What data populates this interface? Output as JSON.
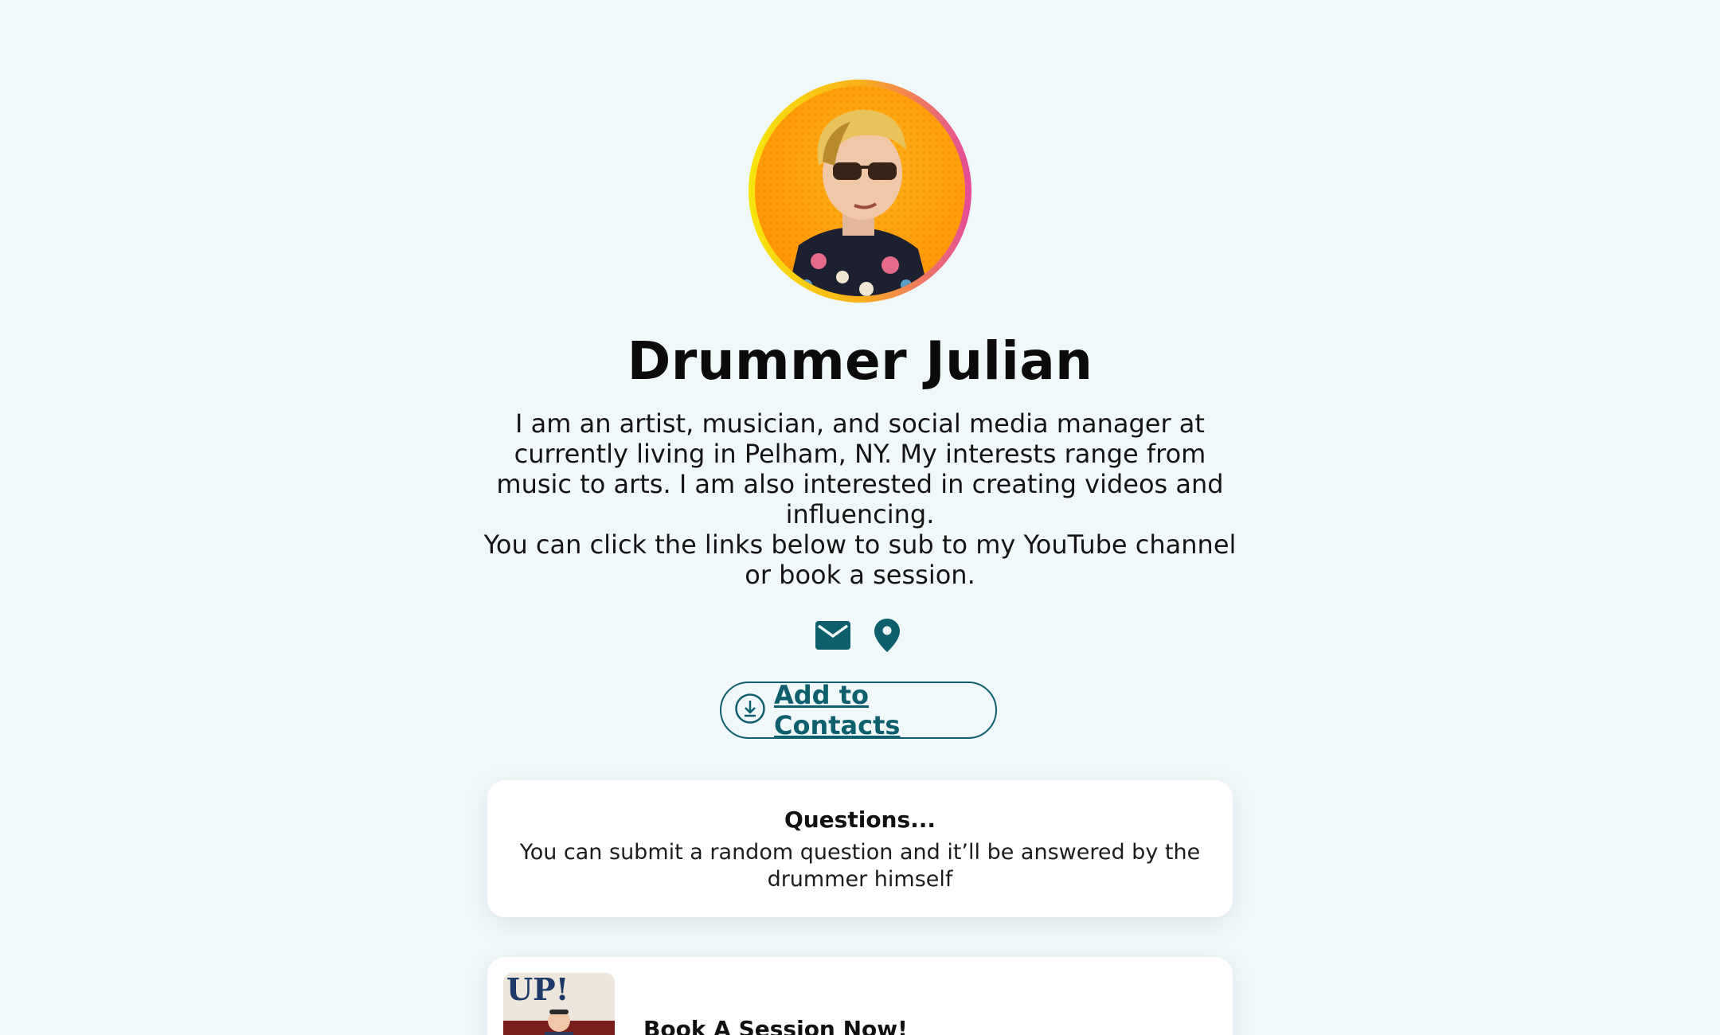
{
  "profile": {
    "name": "Drummer Julian",
    "avatar_alt": "Drummer Julian avatar",
    "bio_lines": [
      "I am an artist, musician, and social media manager at currently living in Pelham, NY. My interests range from music to arts. I am also interested in creating videos and influencing.",
      "You can click the links below to sub to my YouTube channel or book a session."
    ]
  },
  "contact_icons": [
    {
      "icon": "mail-icon"
    },
    {
      "icon": "location-pin-icon"
    }
  ],
  "add_contacts": {
    "label": "Add to Contacts",
    "icon": "download-circle-icon"
  },
  "questions_card": {
    "title": "Questions...",
    "text": "You can submit a random question and it’ll be answered by the drummer himself"
  },
  "session_card": {
    "label": "Book A Session Now!",
    "thumb_text": "UP!"
  },
  "colors": {
    "background": "#f1f8fa",
    "accent": "#0d5f6e",
    "avatar_ring_start": "#f5e60c",
    "avatar_ring_end": "#e44a9a"
  }
}
